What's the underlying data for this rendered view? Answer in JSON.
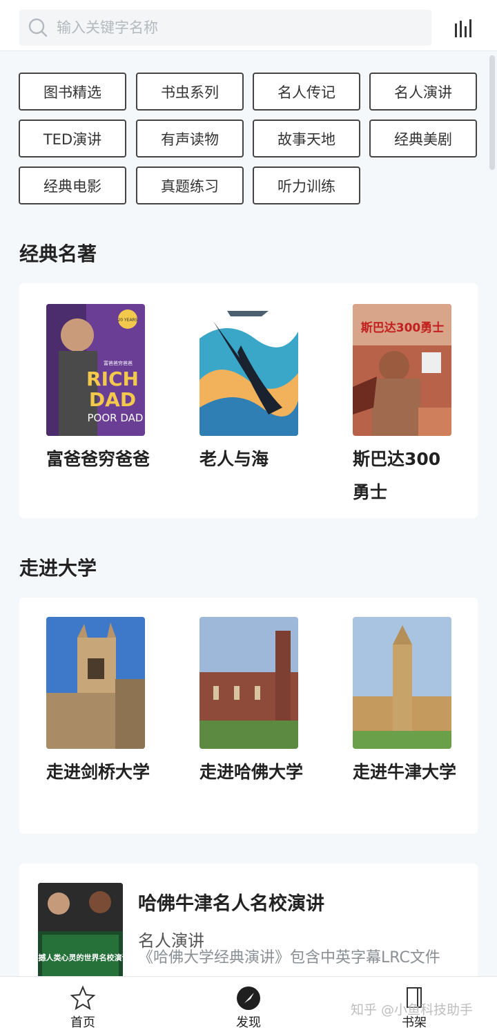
{
  "search": {
    "placeholder": "输入关键字名称"
  },
  "tags": [
    "图书精选",
    "书虫系列",
    "名人传记",
    "名人演讲",
    "TED演讲",
    "有声读物",
    "故事天地",
    "经典美剧",
    "经典电影",
    "真题练习",
    "听力训练"
  ],
  "sections": [
    {
      "title": "经典名著",
      "books": [
        "富爸爸穷爸爸",
        "老人与海",
        "斯巴达300勇士"
      ]
    },
    {
      "title": "走进大学",
      "books": [
        "走进剑桥大学",
        "走进哈佛大学",
        "走进牛津大学"
      ]
    }
  ],
  "covers": {
    "rich_dad": {
      "line1": "RICH",
      "line2": "DAD",
      "line3": "POOR DAD",
      "cn": "富爸爸穷爸爸",
      "badge": "20 YEARS"
    },
    "spartan": {
      "top": "斯巴达300勇士"
    }
  },
  "feature": {
    "title": "哈佛牛津名人名校演讲",
    "category": "名人演讲",
    "description": "《哈佛大学经典演讲》包含中英字幕LRC文件",
    "thumb_text": "震撼人类心灵的世界名校演讲"
  },
  "nav": [
    {
      "label": "首页",
      "icon": "star-icon"
    },
    {
      "label": "发现",
      "icon": "compass-icon"
    },
    {
      "label": "书架",
      "icon": "bookshelf-icon"
    }
  ],
  "watermark": "知乎 @小鱼科技助手"
}
